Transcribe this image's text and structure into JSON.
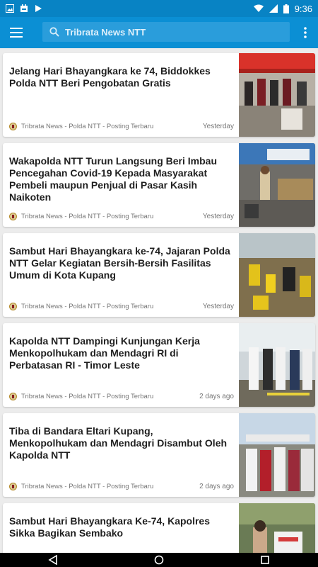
{
  "status_bar": {
    "time": "9:36"
  },
  "app_bar": {
    "search_text": "Tribrata News NTT"
  },
  "articles": [
    {
      "title": "Jelang Hari Bhayangkara ke 74, Biddokkes Polda NTT Beri Pengobatan Gratis",
      "source": "Tribrata News - Polda NTT - Posting Terbaru",
      "time": "Yesterday"
    },
    {
      "title": "Wakapolda NTT Turun Langsung Beri Imbau Pencegahan Covid-19 Kepada Masyarakat Pembeli maupun Penjual di Pasar Kasih Naikoten",
      "source": "Tribrata News - Polda NTT - Posting Terbaru",
      "time": "Yesterday"
    },
    {
      "title": "Sambut Hari Bhayangkara ke-74, Jajaran Polda NTT Gelar Kegiatan Bersih-Bersih Fasilitas Umum di Kota Kupang",
      "source": "Tribrata News - Polda NTT - Posting Terbaru",
      "time": "Yesterday"
    },
    {
      "title": "Kapolda NTT Dampingi Kunjungan Kerja Menkopolhukam dan Mendagri RI di Perbatasan RI - Timor Leste",
      "source": "Tribrata News - Polda NTT - Posting Terbaru",
      "time": "2 days ago"
    },
    {
      "title": "Tiba di Bandara Eltari Kupang, Menkopolhukam dan Mendagri Disambut Oleh Kapolda NTT",
      "source": "Tribrata News - Polda NTT - Posting Terbaru",
      "time": "2 days ago"
    },
    {
      "title": "Sambut Hari Bhayangkara Ke-74, Kapolres Sikka Bagikan Sembako",
      "source": "",
      "time": ""
    }
  ]
}
